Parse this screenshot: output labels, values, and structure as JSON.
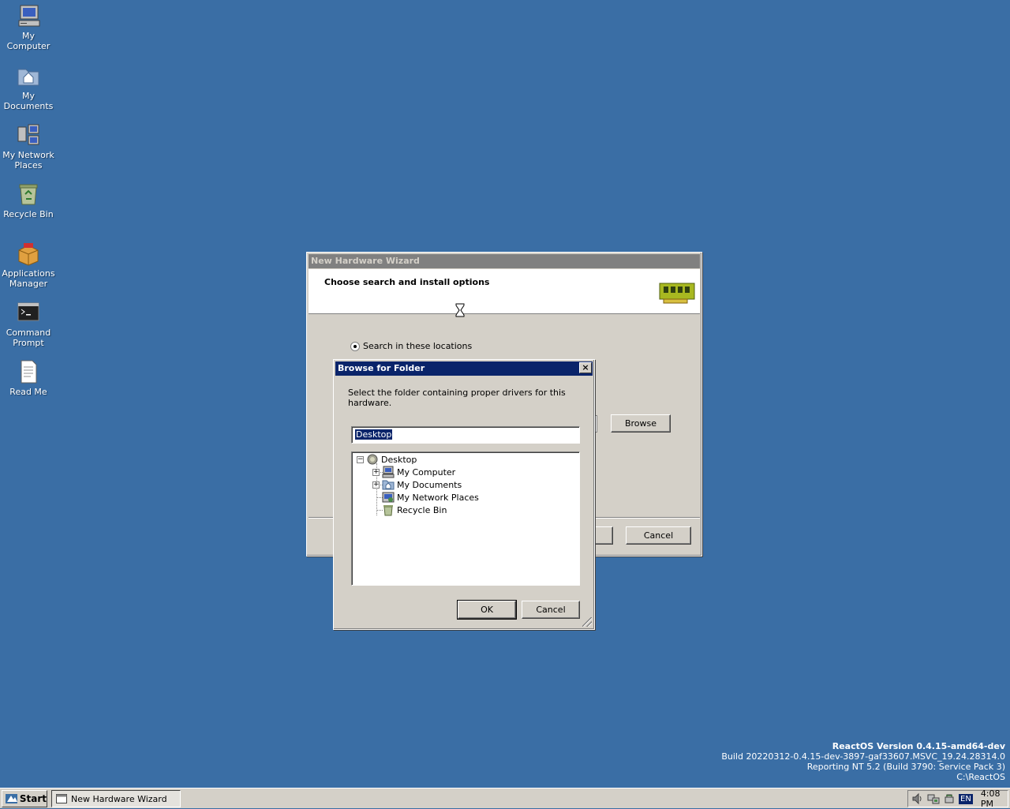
{
  "desktop": {
    "icons": [
      {
        "label_line1": "My",
        "label_line2": "Computer"
      },
      {
        "label_line1": "My",
        "label_line2": "Documents"
      },
      {
        "label_line1": "My Network",
        "label_line2": "Places"
      },
      {
        "label_line1": "Recycle Bin",
        "label_line2": ""
      },
      {
        "label_line1": "Applications",
        "label_line2": "Manager"
      },
      {
        "label_line1": "Command",
        "label_line2": "Prompt"
      },
      {
        "label_line1": "Read Me",
        "label_line2": ""
      }
    ]
  },
  "wizard": {
    "title": "New Hardware Wizard",
    "heading": "Choose search and install options",
    "radio_label": "Search in these locations",
    "browse_label": "Browse",
    "cancel_label": "Cancel"
  },
  "browse_dialog": {
    "title": "Browse for Folder",
    "close_label": "×",
    "description": "Select the folder containing proper drivers for this hardware.",
    "folder_value": "Desktop",
    "tree": {
      "root": "Desktop",
      "children": [
        "My Computer",
        "My Documents",
        "My Network Places",
        "Recycle Bin"
      ]
    },
    "ok_label": "OK",
    "cancel_label": "Cancel"
  },
  "version_info": {
    "line1": "ReactOS Version 0.4.15-amd64-dev",
    "line2": "Build 20220312-0.4.15-dev-3897-gaf33607.MSVC_19.24.28314.0",
    "line3": "Reporting NT 5.2 (Build 3790: Service Pack 3)",
    "line4": "C:\\ReactOS"
  },
  "taskbar": {
    "start_label": "Start",
    "task_label": "New Hardware Wizard",
    "lang": "EN",
    "clock": "4:08 PM"
  },
  "colors": {
    "desktop": "#3a6ea5",
    "active_title": "#0a246a",
    "inactive_title": "#808080",
    "face": "#d4d0c8"
  }
}
